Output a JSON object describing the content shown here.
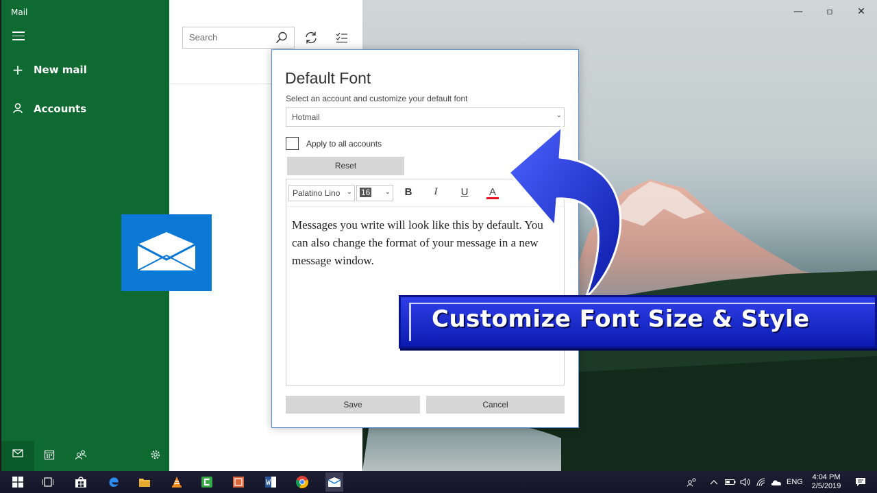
{
  "app": {
    "title": "Mail",
    "new_mail_label": "New mail",
    "accounts_label": "Accounts"
  },
  "search": {
    "placeholder": "Search"
  },
  "dialog": {
    "title": "Default Font",
    "subtitle": "Select an account and customize your default font",
    "account_selected": "Hotmail",
    "apply_all_label": "Apply to all accounts",
    "apply_all_checked": false,
    "reset_label": "Reset",
    "font_name": "Palatino Lino",
    "font_size": "16",
    "bold_label": "B",
    "italic_label": "I",
    "underline_label": "U",
    "color_label": "A",
    "preview_text": "Messages you write will look like this by default. You can also change the format of your message in a new message window.",
    "save_label": "Save",
    "cancel_label": "Cancel"
  },
  "banner": {
    "text": "Customize Font Size & Style"
  },
  "taskbar": {
    "language": "ENG",
    "time": "4:04 PM",
    "date": "2/5/2019"
  },
  "colors": {
    "sidebar": "#0f6a32",
    "mail_blue": "#0a78d4",
    "banner_blue": "#1a2bd0",
    "font_color_bar": "#e81123"
  },
  "icons": {
    "menu": "hamburger-icon",
    "new_mail": "plus-icon",
    "accounts": "person-icon",
    "search": "search-icon",
    "sync": "sync-icon",
    "select": "checklist-icon",
    "mail": "mail-icon",
    "calendar": "calendar-icon",
    "people": "people-icon",
    "settings": "gear-icon"
  }
}
